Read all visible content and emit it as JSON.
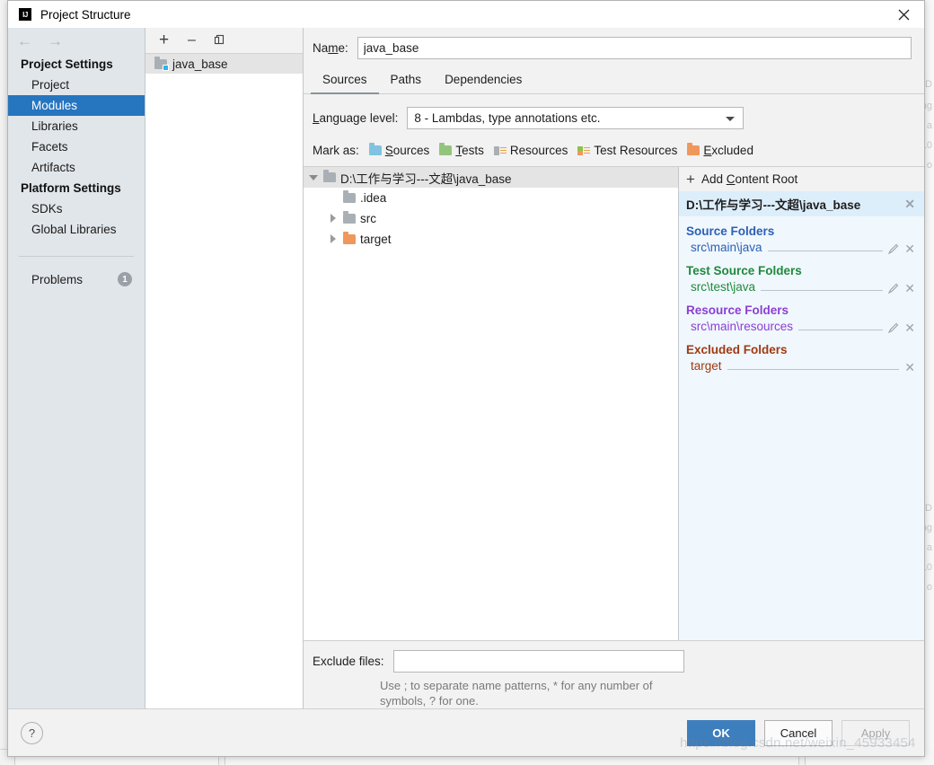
{
  "window": {
    "title": "Project Structure",
    "logo_icon": "intellij-idea-logo",
    "close_icon": "close-icon"
  },
  "nav": {
    "back_icon": "arrow-left-icon",
    "forward_icon": "arrow-right-icon",
    "groups": [
      {
        "title": "Project Settings",
        "items": [
          "Project",
          "Modules",
          "Libraries",
          "Facets",
          "Artifacts"
        ]
      },
      {
        "title": "Platform Settings",
        "items": [
          "SDKs",
          "Global Libraries"
        ]
      }
    ],
    "selected": "Modules",
    "problems": {
      "label": "Problems",
      "count": "1"
    }
  },
  "modules": {
    "toolbar": {
      "add": "+",
      "remove": "–",
      "copy_icon": "copy-icon"
    },
    "items": [
      {
        "label": "java_base",
        "icon": "module-folder-icon",
        "selected": true
      }
    ]
  },
  "editor": {
    "name_label": "Name:",
    "name_value": "java_base",
    "tabs": [
      {
        "label": "Sources",
        "active": true
      },
      {
        "label": "Paths",
        "active": false
      },
      {
        "label": "Dependencies",
        "active": false
      }
    ],
    "language_level": {
      "label": "Language level:",
      "value": "8 - Lambdas, type annotations etc.",
      "caret_icon": "chevron-down-icon"
    },
    "mark_as": {
      "label": "Mark as:",
      "options": [
        {
          "label": "Sources",
          "icon": "folder-blue-icon",
          "color": "#7fc3e0"
        },
        {
          "label": "Tests",
          "icon": "folder-green-icon",
          "color": "#93c47d"
        },
        {
          "label": "Resources",
          "icon": "resources-icon",
          "color": "#a9b0b5"
        },
        {
          "label": "Test Resources",
          "icon": "test-resources-icon",
          "color": "#8bc34a"
        },
        {
          "label": "Excluded",
          "icon": "folder-orange-icon",
          "color": "#f0975c"
        }
      ]
    }
  },
  "tree": {
    "nodes": [
      {
        "label": "D:\\工作与学习---文超\\java_base",
        "icon": "folder-grey-icon",
        "twisty": "open",
        "depth": 0,
        "selected": true
      },
      {
        "label": ".idea",
        "icon": "folder-grey-icon",
        "twisty": "none",
        "depth": 1,
        "selected": false
      },
      {
        "label": "src",
        "icon": "folder-grey-icon",
        "twisty": "closed",
        "depth": 1,
        "selected": false
      },
      {
        "label": "target",
        "icon": "folder-orange-icon",
        "twisty": "closed",
        "depth": 1,
        "selected": false
      }
    ]
  },
  "roots": {
    "add_content_root": "Add Content Root",
    "add_icon": "plus-icon",
    "content_root": "D:\\工作与学习---文超\\java_base",
    "remove_icon": "close-icon",
    "groups": [
      {
        "title": "Source Folders",
        "color": "#2b60b5",
        "class": "src",
        "entries": [
          {
            "path": "src\\main\\java",
            "has_edit": true
          }
        ]
      },
      {
        "title": "Test Source Folders",
        "color": "#1f8a3c",
        "class": "test",
        "entries": [
          {
            "path": "src\\test\\java",
            "has_edit": true
          }
        ]
      },
      {
        "title": "Resource Folders",
        "color": "#8b3fd4",
        "class": "res",
        "entries": [
          {
            "path": "src\\main\\resources",
            "has_edit": true
          }
        ]
      },
      {
        "title": "Excluded Folders",
        "color": "#a03a12",
        "class": "exc",
        "entries": [
          {
            "path": "target",
            "has_edit": false
          }
        ]
      }
    ]
  },
  "exclude": {
    "label": "Exclude files:",
    "value": "",
    "placeholder": "",
    "hint": "Use ; to separate name patterns, * for any number of symbols, ? for one."
  },
  "footer": {
    "help_label": "?",
    "ok": "OK",
    "cancel": "Cancel",
    "apply": "Apply",
    "accent_color": "#3d7ebd"
  },
  "watermark": "https://blog.csdn.net/weixin_45933454",
  "background_ghost": {
    "lines": [
      "\\D",
      "ng",
      "a",
      "10",
      "o"
    ]
  }
}
